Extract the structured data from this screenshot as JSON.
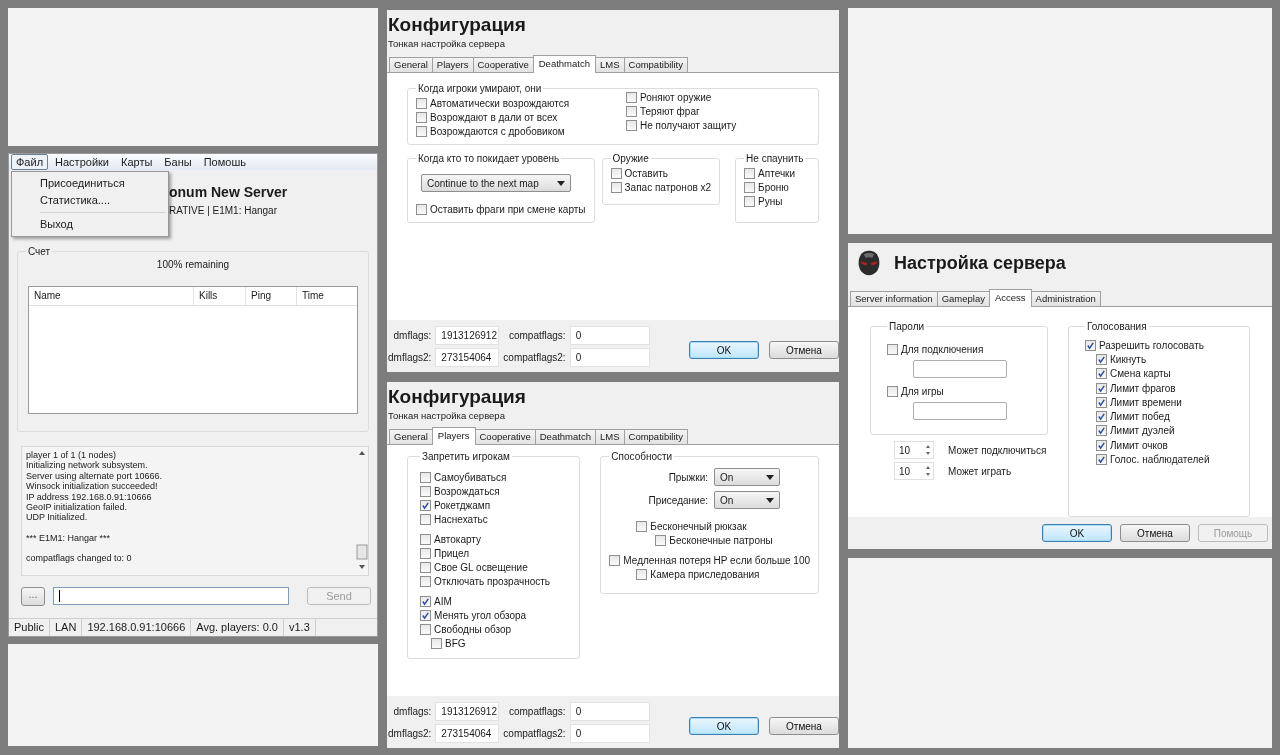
{
  "server_window": {
    "menu": [
      {
        "label": "Файл",
        "selected": true
      },
      {
        "label": "Настройки",
        "selected": false
      },
      {
        "label": "Карты",
        "selected": false
      },
      {
        "label": "Баны",
        "selected": false
      },
      {
        "label": "Помошь",
        "selected": false
      }
    ],
    "file_menu": [
      [
        "Присоединиться",
        "Статистика...."
      ],
      [
        "Выход"
      ]
    ],
    "server_name": "onum New Server",
    "server_info": "RATIVE | E1M1: Hangar",
    "score_group": "Счет",
    "remaining": "100% remaining",
    "columns": [
      "Name",
      "Kills",
      "Ping",
      "Time"
    ],
    "log": [
      [
        "player 1 of 1 (1 nodes)",
        "Initializing network subsystem.",
        "Server using alternate port 10666.",
        "Winsock initialization succeeded!",
        "IP address 192.168.0.91:10666",
        "GeoIP initialization failed.",
        "UDP Initialized."
      ],
      [
        "*** E1M1: Hangar ***"
      ],
      [
        "compatflags changed to: 0"
      ]
    ],
    "more_button": "...",
    "send_button": {
      "label": "Send",
      "disabled": true
    },
    "status": [
      "Public",
      "LAN",
      "192.168.0.91:10666",
      "Avg. players: 0.0",
      "v1.3"
    ]
  },
  "config_dialogs": [
    {
      "kind": "deathmatch",
      "title": "Конфигурация",
      "subtitle": "Тонкая настройка сервера",
      "tabs": [
        {
          "label": "General",
          "selected": false
        },
        {
          "label": "Players",
          "selected": false
        },
        {
          "label": "Cooperative",
          "selected": false
        },
        {
          "label": "Deathmatch",
          "selected": true
        },
        {
          "label": "LMS",
          "selected": false
        },
        {
          "label": "Compatibility",
          "selected": false
        }
      ],
      "die_group": {
        "title": "Когда игроки умирают, они",
        "columns": [
          [
            {
              "label": "Автоматически возрождаются",
              "checked": false
            },
            {
              "label": "Возрождают в дали от всех",
              "checked": false
            },
            {
              "label": "Возрождаются с дробовиком",
              "checked": false
            }
          ],
          [
            {
              "label": "Роняют оружие",
              "checked": false
            },
            {
              "label": "Теряют фраг",
              "checked": false
            },
            {
              "label": "Не получают защиту",
              "checked": false
            }
          ]
        ]
      },
      "leave_group": {
        "title": "Когда кто то покидает уровень",
        "select": "Continue to the next map",
        "option": {
          "label": "Оставить фраги при смене карты",
          "checked": false
        }
      },
      "small_groups": [
        {
          "title": "Оружие",
          "items": [
            {
              "label": "Оставить",
              "checked": false
            },
            {
              "label": "Запас патронов x2",
              "checked": false
            }
          ]
        },
        {
          "title": "Не спаунить",
          "items": [
            {
              "label": "Аптечки",
              "checked": false
            },
            {
              "label": "Броню",
              "checked": false
            },
            {
              "label": "Руны",
              "checked": false
            }
          ]
        }
      ],
      "flags": [
        {
          "label": "dmflags:",
          "value": "1913126912"
        },
        {
          "label": "compatflags:",
          "value": "0"
        },
        {
          "label": "dmflags2:",
          "value": "273154064"
        },
        {
          "label": "compatflags2:",
          "value": "0"
        }
      ],
      "buttons": [
        {
          "label": "OK",
          "default": true
        },
        {
          "label": "Отмена",
          "default": false
        }
      ]
    },
    {
      "kind": "players",
      "title": "Конфигурация",
      "subtitle": "Тонкая настройка сервера",
      "tabs": [
        {
          "label": "General",
          "selected": false
        },
        {
          "label": "Players",
          "selected": true
        },
        {
          "label": "Cooperative",
          "selected": false
        },
        {
          "label": "Deathmatch",
          "selected": false
        },
        {
          "label": "LMS",
          "selected": false
        },
        {
          "label": "Compatibility",
          "selected": false
        }
      ],
      "deny_group": {
        "title": "Запретить игрокам",
        "sections": [
          [
            {
              "label": "Самоубиваться",
              "checked": false
            },
            {
              "label": "Возрождаться",
              "checked": false
            },
            {
              "label": "Рокетджамп",
              "checked": true
            },
            {
              "label": "Наснехатьс",
              "checked": false
            }
          ],
          [
            {
              "label": "Автокарту",
              "checked": false
            },
            {
              "label": "Прицел",
              "checked": false
            },
            {
              "label": "Свое GL освещение",
              "checked": false
            },
            {
              "label": "Отключать прозрачность",
              "checked": false
            }
          ],
          [
            {
              "label": "AIM",
              "checked": true
            },
            {
              "label": "Менять угол обзора",
              "checked": true
            },
            {
              "label": "Свободны обзор",
              "checked": false,
              "children": [
                {
                  "label": "BFG",
                  "checked": false
                }
              ]
            }
          ]
        ]
      },
      "abilities_group": {
        "title": "Способности",
        "selects": [
          {
            "label": "Прыжки:",
            "value": "On"
          },
          {
            "label": "Приседание:",
            "value": "On"
          }
        ],
        "items": [
          {
            "label": "Бесконечный рюкзак",
            "checked": false,
            "children": [
              {
                "label": "Бесконечные патроны",
                "checked": false
              }
            ]
          },
          {
            "label": "Медленная потеря HP если больше 100",
            "checked": false,
            "children": [
              {
                "label": "Камера приследования",
                "checked": false
              }
            ]
          }
        ]
      },
      "flags": [
        {
          "label": "dmflags:",
          "value": "1913126912"
        },
        {
          "label": "compatflags:",
          "value": "0"
        },
        {
          "label": "dmflags2:",
          "value": "273154064"
        },
        {
          "label": "compatflags2:",
          "value": "0"
        }
      ],
      "buttons": [
        {
          "label": "OK",
          "default": true
        },
        {
          "label": "Отмена",
          "default": false
        }
      ]
    }
  ],
  "server_setup": {
    "title": "Настройка сервера",
    "tabs": [
      {
        "label": "Server information",
        "selected": false
      },
      {
        "label": "Gameplay",
        "selected": false
      },
      {
        "label": "Access",
        "selected": true
      },
      {
        "label": "Administration",
        "selected": false
      }
    ],
    "passwords": {
      "title": "Пароли",
      "items": [
        {
          "label": "Для подключения",
          "checked": false
        },
        {
          "label": "Для игры",
          "checked": false
        }
      ]
    },
    "limits": [
      {
        "value": "10",
        "label": "Может подключиться"
      },
      {
        "value": "10",
        "label": "Может играть"
      }
    ],
    "voting": {
      "title": "Голосования",
      "master": {
        "label": "Разрешить голосовать",
        "checked": true
      },
      "items": [
        {
          "label": "Кикнуть",
          "checked": true
        },
        {
          "label": "Смена карты",
          "checked": true
        },
        {
          "label": "Лимит фрагов",
          "checked": true
        },
        {
          "label": "Лимит времени",
          "checked": true
        },
        {
          "label": "Лимит побед",
          "checked": true
        },
        {
          "label": "Лимит дуэлей",
          "checked": true
        },
        {
          "label": "Лимит очков",
          "checked": true
        },
        {
          "label": "Голос. наблюдателей",
          "checked": true
        }
      ]
    },
    "buttons": [
      {
        "label": "OK",
        "default": true,
        "disabled": false
      },
      {
        "label": "Отмена",
        "default": false,
        "disabled": false
      },
      {
        "label": "Помощь",
        "default": false,
        "disabled": true
      }
    ]
  }
}
